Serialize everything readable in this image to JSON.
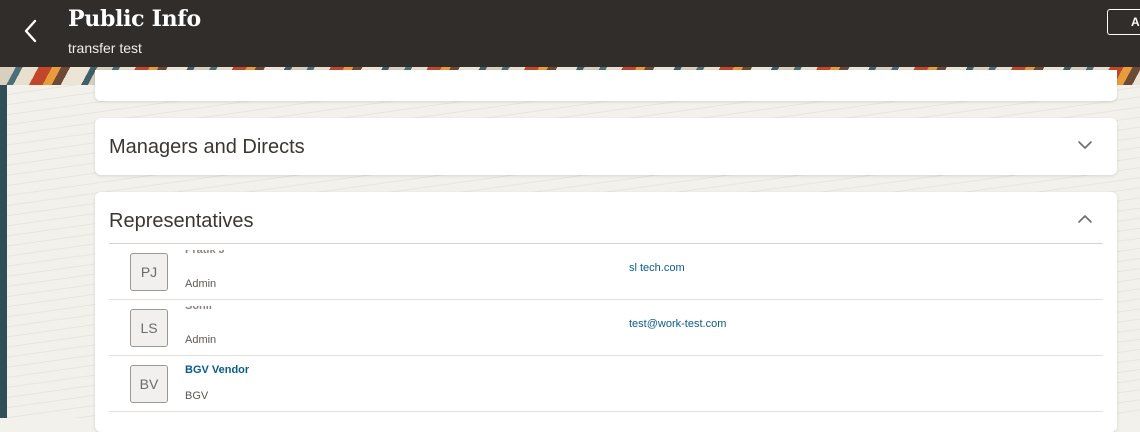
{
  "header": {
    "title": "Public Info",
    "subtitle": "transfer test",
    "action_label": "Ac",
    "back_icon": "chevron-left-icon",
    "bg_color": "#312d2a"
  },
  "sections": {
    "managers": {
      "title": "Managers and Directs",
      "state_icon": "chevron-down-icon"
    },
    "representatives": {
      "title": "Representatives",
      "state_icon": "chevron-up-icon",
      "rows": [
        {
          "initials": "PJ",
          "name": "Pratik J",
          "role": "Admin",
          "email": "sl                    tech.com"
        },
        {
          "initials": "LS",
          "name": "              Sonil",
          "role": "Admin",
          "email": "test@work-test.com"
        },
        {
          "initials": "BV",
          "name": "BGV Vendor",
          "role": "BGV",
          "email": ""
        }
      ]
    }
  },
  "colors": {
    "link": "#0b5b8c",
    "text": "#3a3632"
  }
}
